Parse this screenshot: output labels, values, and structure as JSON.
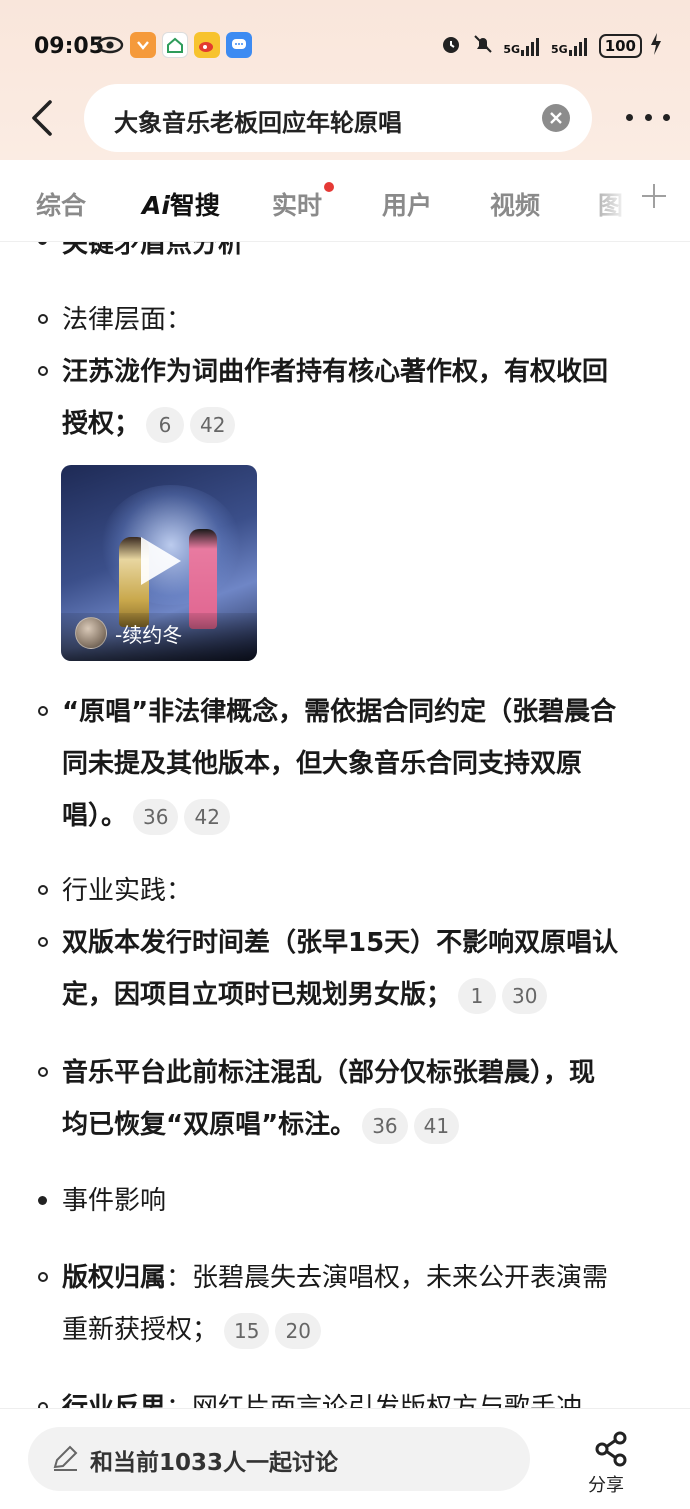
{
  "status_bar": {
    "time": "09:05",
    "network1": "5G",
    "network2": "5G",
    "battery": "100"
  },
  "header": {
    "search_query": "大象音乐老板回应年轮原唱"
  },
  "tabs": [
    {
      "label": "综合"
    },
    {
      "label_ai": "Ai",
      "label": "智搜"
    },
    {
      "label": "实时"
    },
    {
      "label": "用户"
    },
    {
      "label": "视频"
    },
    {
      "label": "图"
    }
  ],
  "content": {
    "cut_heading": "关键矛盾点分析",
    "legal_heading": "法律层面：",
    "legal_point1_line1": "汪苏泷作为词曲作者持有核心著作权，有权收回",
    "legal_point1_line2": "授权；",
    "legal_point1_cites": [
      "6",
      "42"
    ],
    "video_author": "-续约冬",
    "legal_point2_line1": "“原唱”非法律概念，需依据合同约定（张碧晨合",
    "legal_point2_line2": "同未提及其他版本，但大象音乐合同支持双原",
    "legal_point2_line3": "唱）。",
    "legal_point2_cites": [
      "36",
      "42"
    ],
    "industry_heading": "行业实践：",
    "industry_point1_line1": "双版本发行时间差（张早15天）不影响双原唱认",
    "industry_point1_line2": "定，因项目立项时已规划男女版；",
    "industry_point1_cites": [
      "1",
      "30"
    ],
    "industry_point2_line1": "音乐平台此前标注混乱（部分仅标张碧晨），现",
    "industry_point2_line2": "均已恢复“双原唱”标注。",
    "industry_point2_cites": [
      "36",
      "41"
    ],
    "impact_heading": "事件影响",
    "copyright_label": "版权归属",
    "copyright_line1": "：张碧晨失去演唱权，未来公开表演需",
    "copyright_line2": "重新获授权；",
    "copyright_cites": [
      "15",
      "20"
    ],
    "reflection_label": "行业反思",
    "reflection_line1": "：网红片面言论引发版权方与歌手冲"
  },
  "bottom_bar": {
    "discuss_label": "和当前1033人一起讨论",
    "share_label": "分享"
  }
}
